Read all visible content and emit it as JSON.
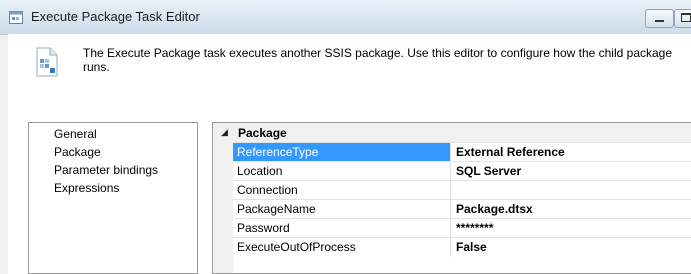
{
  "window": {
    "title": "Execute Package Task Editor"
  },
  "header": {
    "icon": "package-document-icon",
    "description": "The Execute Package task executes another SSIS package. Use this editor to configure how the child package runs."
  },
  "nav": {
    "items": [
      {
        "label": "General"
      },
      {
        "label": "Package"
      },
      {
        "label": "Parameter bindings"
      },
      {
        "label": "Expressions"
      }
    ]
  },
  "grid": {
    "category": "Package",
    "properties": [
      {
        "name": "ReferenceType",
        "value": "External Reference",
        "selected": true
      },
      {
        "name": "Location",
        "value": "SQL Server"
      },
      {
        "name": "Connection",
        "value": ""
      },
      {
        "name": "PackageName",
        "value": "Package.dtsx"
      },
      {
        "name": "Password",
        "value": "********"
      },
      {
        "name": "ExecuteOutOfProcess",
        "value": "False"
      }
    ]
  },
  "colors": {
    "selection": "#3399ff",
    "titlebar": "#cddcec"
  }
}
